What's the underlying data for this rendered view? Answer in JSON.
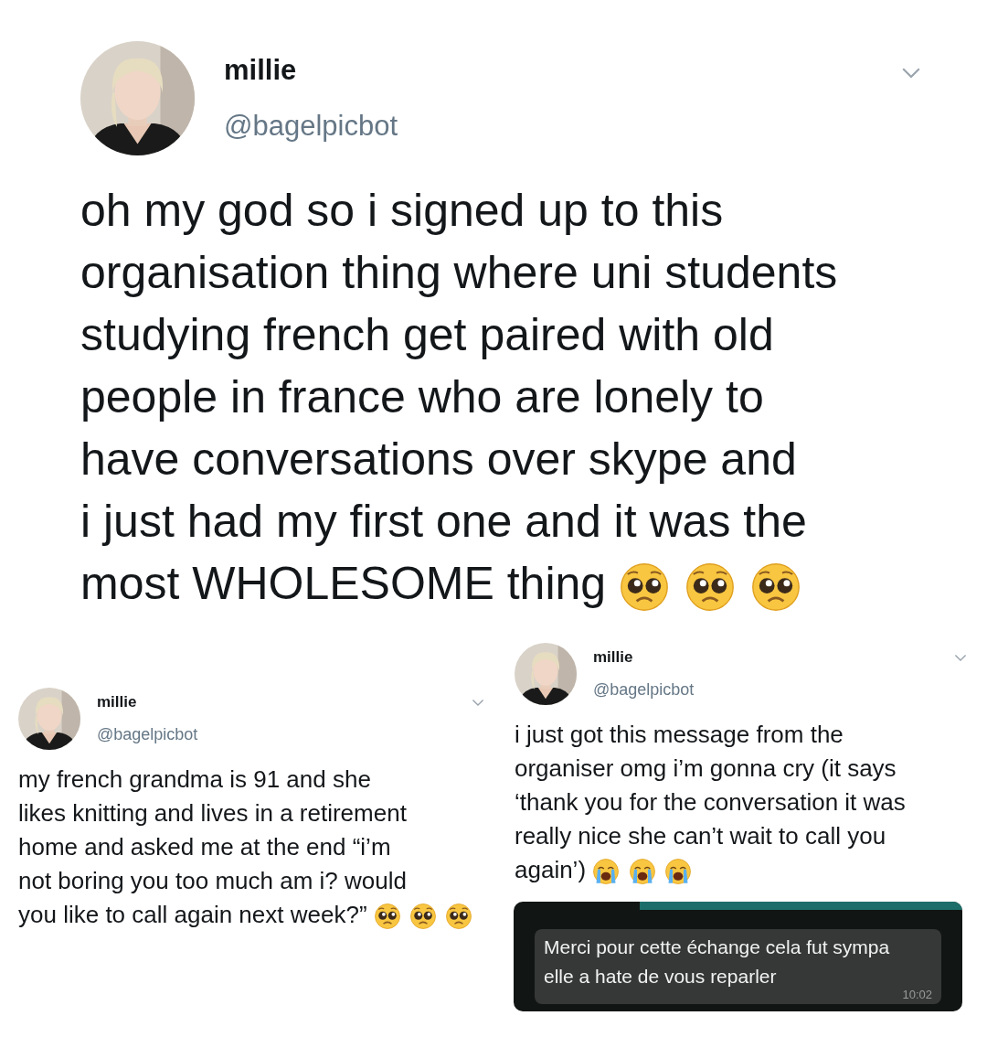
{
  "main_tweet": {
    "name": "millie",
    "handle": "@bagelpicbot",
    "text": "oh my god so i signed up to this\norganisation thing where uni students\nstudying french get paired with old\npeople in france who are lonely to\nhave conversations over skype and\ni just had my first one and it was the\nmost WHOLESOME thing",
    "emojis": [
      {
        "kind": "pleading"
      },
      {
        "kind": "pleading"
      },
      {
        "kind": "pleading"
      }
    ]
  },
  "left_tweet": {
    "name": "millie",
    "handle": "@bagelpicbot",
    "text": "my french grandma is 91 and she\nlikes knitting and lives in a retirement\nhome and asked me at the end “i’m\nnot boring you too much am i? would\nyou like to call again next week?”",
    "emojis": [
      {
        "kind": "pleading"
      },
      {
        "kind": "pleading"
      },
      {
        "kind": "pleading"
      }
    ]
  },
  "right_tweet": {
    "name": "millie",
    "handle": "@bagelpicbot",
    "text": "i just got this message from the\norganiser omg i’m gonna cry (it says\n‘thank you for the conversation it was\nreally nice she can’t wait to call you\nagain’)",
    "emojis": [
      {
        "kind": "crying"
      },
      {
        "kind": "crying"
      },
      {
        "kind": "crying"
      }
    ],
    "message": {
      "text": "Merci pour cette échange cela fut sympa\nelle a hate de vous reparler",
      "time": "10:02"
    }
  }
}
